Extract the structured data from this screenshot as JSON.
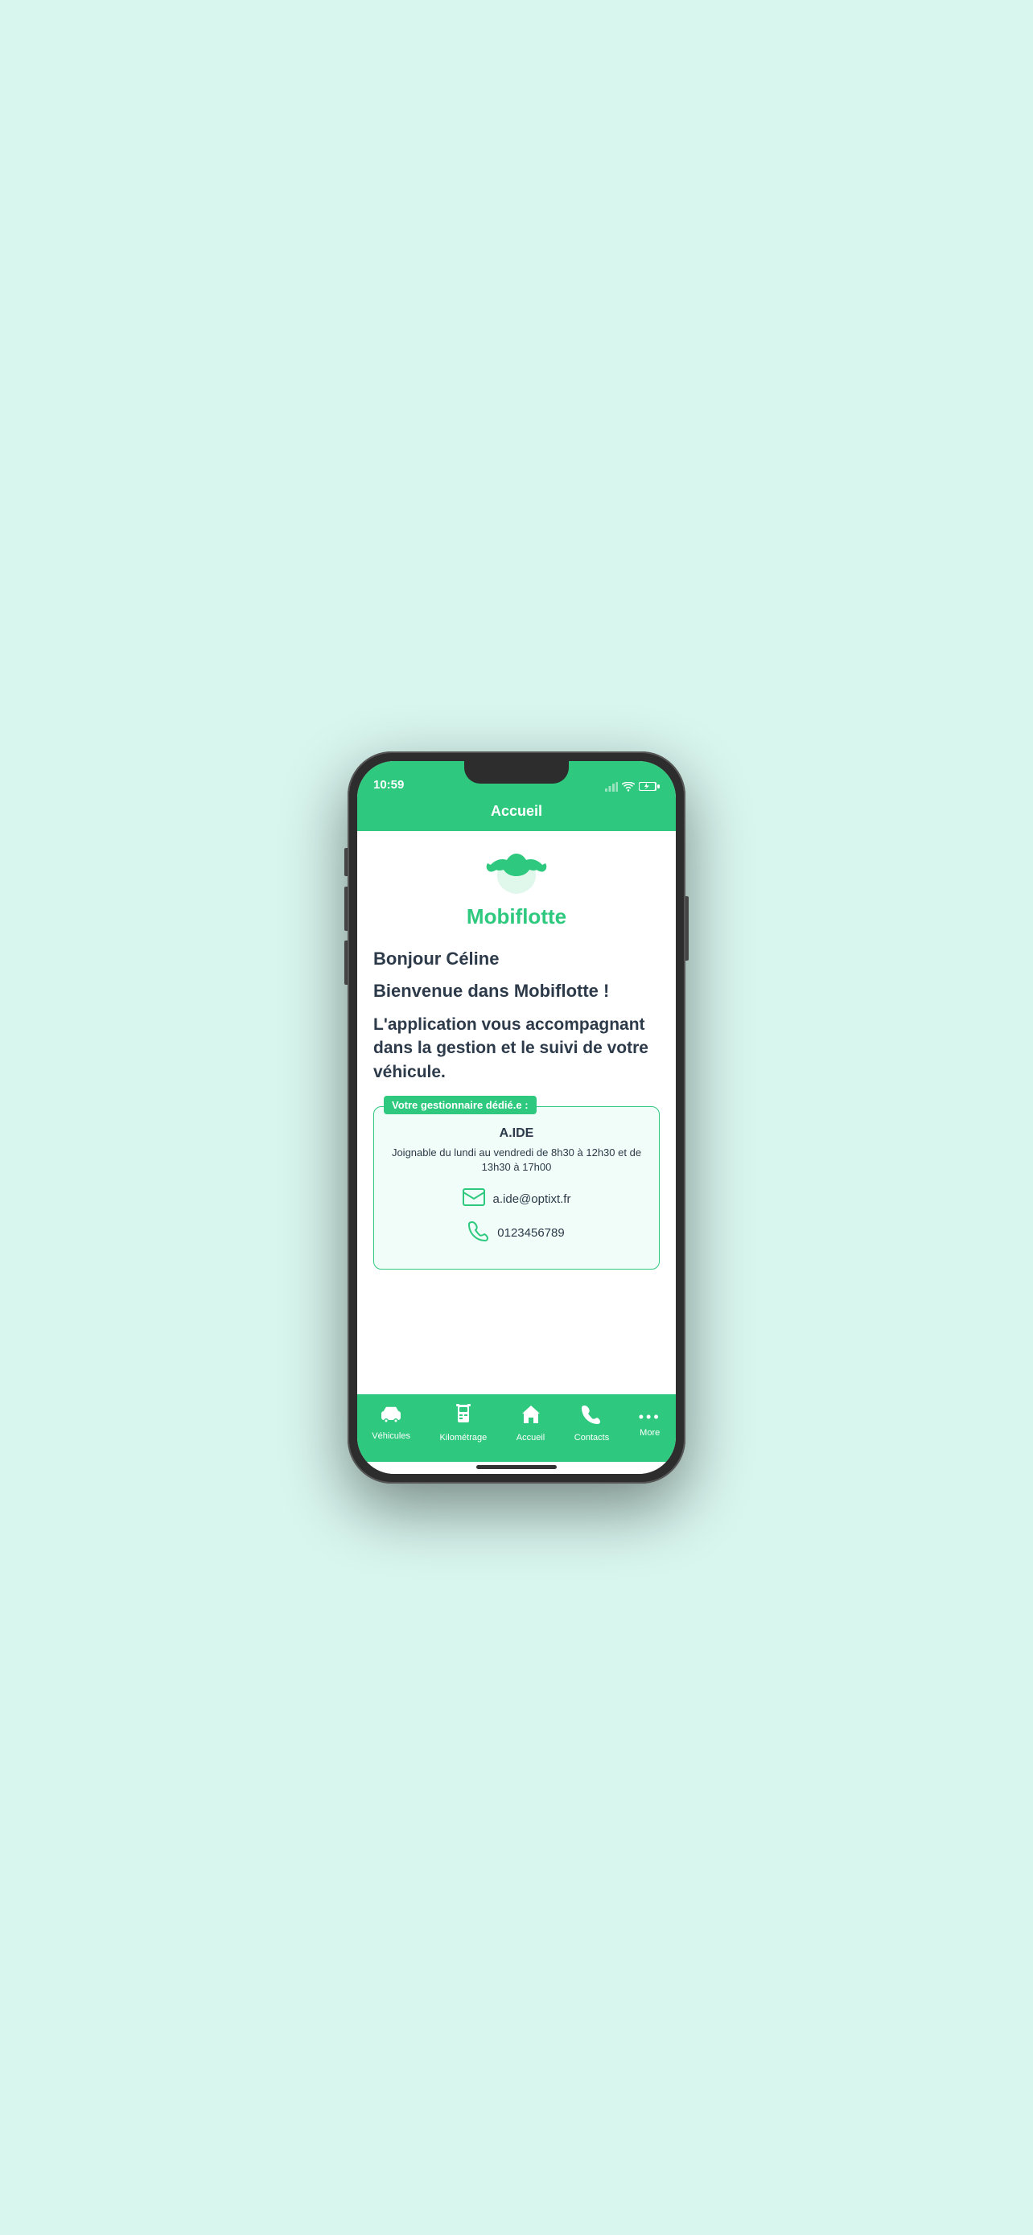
{
  "status_bar": {
    "time": "10:59"
  },
  "header": {
    "title": "Accueil"
  },
  "logo": {
    "text": "Mobiflotte"
  },
  "content": {
    "greeting": "Bonjour Céline",
    "welcome": "Bienvenue dans Mobiflotte !",
    "description": "L'application vous accompagnant dans la gestion et le suivi de votre véhicule.",
    "manager_label": "Votre gestionnaire dédié.e :",
    "manager_name": "A.IDE",
    "manager_hours": "Joignable du lundi au vendredi de 8h30 à 12h30 et de 13h30 à 17h00",
    "manager_email": "a.ide@optixt.fr",
    "manager_phone": "0123456789"
  },
  "nav": {
    "items": [
      {
        "label": "Véhicules",
        "icon": "🚗",
        "active": false
      },
      {
        "label": "Kilométrage",
        "icon": "⛽",
        "active": false
      },
      {
        "label": "Accueil",
        "icon": "🏠",
        "active": true
      },
      {
        "label": "Contacts",
        "icon": "📞",
        "active": false
      },
      {
        "label": "More",
        "icon": "···",
        "active": false
      }
    ]
  },
  "colors": {
    "primary": "#2ec97e",
    "text_dark": "#2d3a4a"
  }
}
